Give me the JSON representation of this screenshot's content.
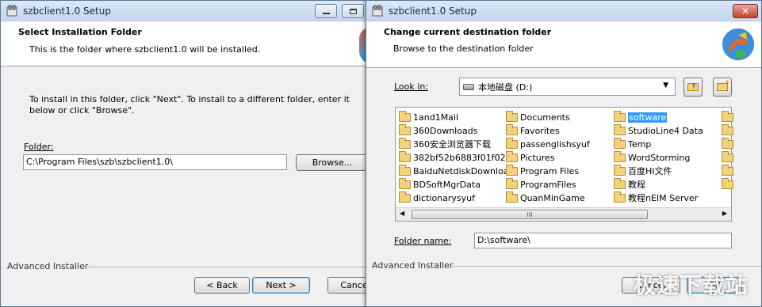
{
  "installer_window": {
    "title": "szbclient1.0 Setup",
    "header_title": "Select Installation Folder",
    "header_subtitle": "This is the folder where szbclient1.0 will be installed.",
    "instructions": "To install in this folder, click \"Next\". To install to a different folder, enter it below or click \"Browse\".",
    "folder_label": "Folder:",
    "folder_value": "C:\\Program Files\\szb\\szbclient1.0\\",
    "browse_label": "Browse...",
    "brand": "Advanced Installer",
    "back_label": "< Back",
    "next_label": "Next >",
    "cancel_label": "Cancel"
  },
  "browse_dialog": {
    "title": "szbclient1.0 Setup",
    "header_title": "Change current destination folder",
    "header_subtitle": "Browse to the destination folder",
    "look_in_label": "Look in:",
    "look_in_value": "本地磁盘 (D:)",
    "folder_name_label": "Folder name:",
    "folder_name_value": "D:\\software\\",
    "brand": "Advanced Installer",
    "cancel_label": "Cancel",
    "ok_label": "OK",
    "scroll_grip": "III",
    "folders_col1": [
      "1and1Mail",
      "360Downloads",
      "360安全浏览器下载",
      "382bf52b6883f01f02",
      "BaiduNetdiskDownload",
      "BDSoftMgrData",
      "dictionarysyuf"
    ],
    "folders_col2": [
      "Documents",
      "Favorites",
      "passenglishsyuf",
      "Pictures",
      "Program Files",
      "ProgramFiles",
      "QuanMinGame"
    ],
    "folders_col3": [
      "software",
      "StudioLine4 Data",
      "Temp",
      "WordStorming",
      "百度HI文件",
      "教程",
      "教程nEIM Server"
    ],
    "selected_folder": "software"
  },
  "watermark": "极速下载站",
  "colors": {
    "selection": "#3399ff",
    "title_bg": "#c3d6ee",
    "folder": "#f2d27a"
  }
}
